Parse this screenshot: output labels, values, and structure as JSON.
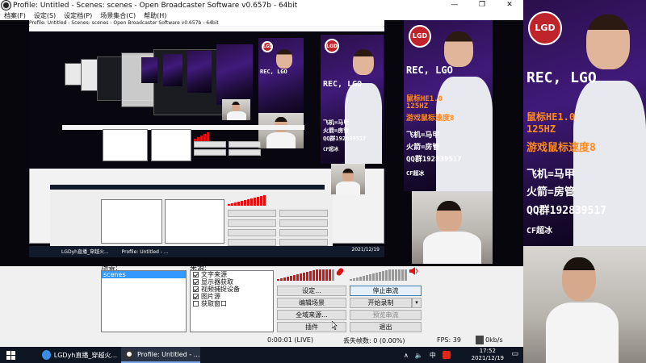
{
  "window": {
    "title": "Profile: Untitled - Scenes: scenes - Open Broadcaster Software v0.657b - 64bit",
    "controls": [
      "—",
      "❐",
      "✕"
    ]
  },
  "menu": [
    "档案(F)",
    "设定(S)",
    "设定档(P)",
    "场景集合(C)",
    "帮助(H)"
  ],
  "dock": {
    "scenes_label": "场景:",
    "sources_label": "来源:",
    "scenes": [
      "scenes"
    ],
    "sources": [
      {
        "label": "文字来源",
        "checked": true
      },
      {
        "label": "显示器获取",
        "checked": true
      },
      {
        "label": "视频捕捉设备",
        "checked": true
      },
      {
        "label": "图片源",
        "checked": true
      },
      {
        "label": "获取窗口",
        "checked": false
      }
    ],
    "buttons": {
      "settings": "设定...",
      "edit_scene": "编辑场景",
      "global_sources": "全域来源...",
      "plugins": "插件",
      "stop_stream": "停止串流",
      "start_record": "开始录制",
      "preview_stream": "预览串流",
      "exit": "退出"
    }
  },
  "status": {
    "time": "0:00:01 (LIVE)",
    "dropped": "丢失帧数: 0 (0.00%)",
    "fps": "FPS: 39",
    "bitrate": "0kb/s"
  },
  "stream_overlay": {
    "badge": "LGD",
    "headline": "REC, LGO",
    "lines": [
      "鼠标HE1.0",
      "125HZ",
      "游戏鼠标速度8",
      "飞机=马甲",
      "火箭=房管",
      "QQ群192839517",
      "CF超冰"
    ]
  },
  "taskbar": {
    "items": [
      {
        "label": "LGDyh直播_穿越火...",
        "active": false
      },
      {
        "label": "Profile: Untitled - ...",
        "active": true
      }
    ],
    "tray": {
      "ime": "中",
      "time": "17:52",
      "date": "2021/12/19"
    }
  },
  "colors": {
    "accent": "#3399ff",
    "meter": "#dd1111",
    "poster_bg": "#2a0f4a",
    "taskbar": "#0f1623"
  }
}
